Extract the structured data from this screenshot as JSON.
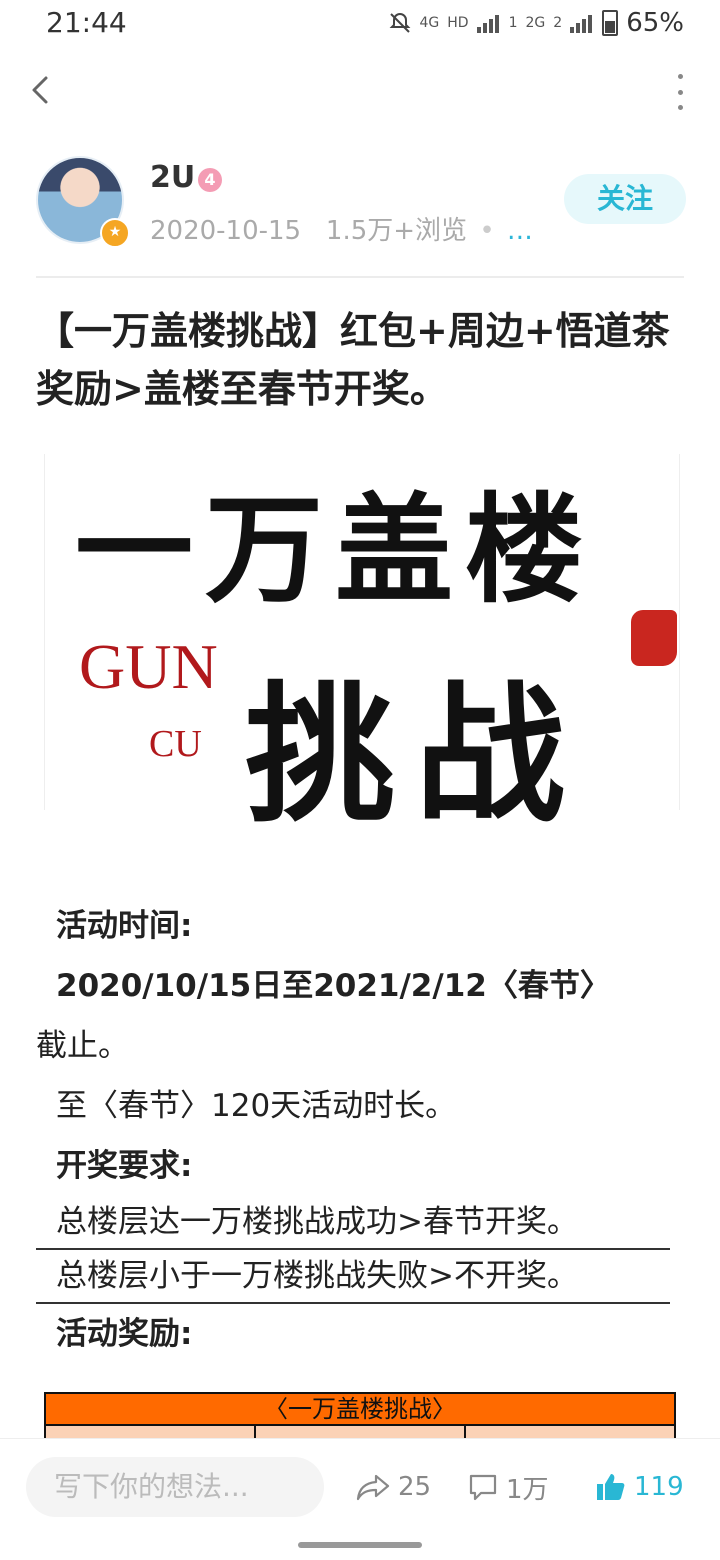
{
  "status_bar": {
    "time": "21:44",
    "net_4g": "4G",
    "hd": "HD",
    "sim1": "1",
    "net_2g": "2G",
    "sim2": "2",
    "battery": "65%"
  },
  "author": {
    "name": "2U",
    "level": "4",
    "date": "2020-10-15",
    "views": "1.5万+浏览",
    "ellipsis": "…",
    "follow_label": "关注"
  },
  "post": {
    "title": "【一万盖楼挑战】红包+周边+悟道茶奖励>盖楼至春节开奖。"
  },
  "banner": {
    "title": "一万盖楼",
    "subtitle": "挑战",
    "logo_g": "GUN",
    "logo_c": "CU"
  },
  "content": {
    "time_label": "活动时间:",
    "time_value": "2020/10/15日至2021/2/12〈春节〉",
    "time_end": "截止。",
    "duration": "至〈春节〉120天活动时长。",
    "requirement_label": "开奖要求:",
    "req_success": "总楼层达一万楼挑战成功>春节开奖。",
    "req_fail": "总楼层小于一万楼挑战失败>不开奖。",
    "reward_label": "活动奖励:"
  },
  "reward_table": {
    "header": "〈一万盖楼挑战〉"
  },
  "bottom_bar": {
    "comment_placeholder": "写下你的想法...",
    "share_count": "25",
    "comment_count": "1万",
    "like_count": "119"
  },
  "colors": {
    "accent": "#29b7d4",
    "banner_red": "#b1191c",
    "table_orange": "#ff6a00"
  },
  "icons": [
    "back-icon",
    "more-icon",
    "mute-icon",
    "signal-icon",
    "battery-icon",
    "share-icon",
    "comment-icon",
    "like-icon"
  ]
}
